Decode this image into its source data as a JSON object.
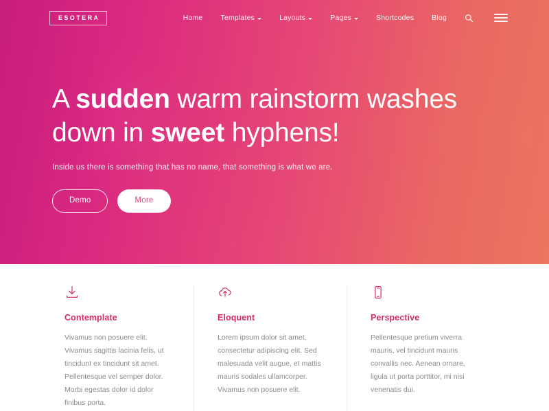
{
  "colors": {
    "gradient_left": "#c61c7d",
    "gradient_right": "#ee7c5c",
    "accent": "#d42b63",
    "button_text": "#e0457a",
    "body_text": "#8b8b8b",
    "divider": "#ececec"
  },
  "header": {
    "logo": "ESOTERA",
    "nav": [
      {
        "label": "Home",
        "has_dropdown": false
      },
      {
        "label": "Templates",
        "has_dropdown": true
      },
      {
        "label": "Layouts",
        "has_dropdown": true
      },
      {
        "label": "Pages",
        "has_dropdown": true
      },
      {
        "label": "Shortcodes",
        "has_dropdown": false
      },
      {
        "label": "Blog",
        "has_dropdown": false
      }
    ],
    "search_icon": "search-icon",
    "menu_icon": "hamburger-menu-icon"
  },
  "hero": {
    "headline_part1": "A ",
    "headline_strong1": "sudden",
    "headline_part2": " warm rainstorm washes down in ",
    "headline_strong2": "sweet",
    "headline_part3": " hyphens!",
    "subtitle": "Inside us there is something that has no name, that something is what we are.",
    "primary_button": "Demo",
    "secondary_button": "More"
  },
  "features": [
    {
      "icon": "download-icon",
      "title": "Contemplate",
      "body": "Vivamus non posuere elit. Vivamus sagittis lacinia felis, ut tincidunt ex tincidunt sit amet. Pellentesque vel semper dolor. Morbi egestas dolor id dolor finibus porta."
    },
    {
      "icon": "cloud-upload-icon",
      "title": "Eloquent",
      "body": "Lorem ipsum dolor sit amet, consectetur adipiscing elit. Sed malesuada velit augue, et mattis mauris sodales ullamcorper. Vivamus non posuere elit."
    },
    {
      "icon": "mobile-phone-icon",
      "title": "Perspective",
      "body": "Pellentesque pretium viverra mauris, vel tincidunt mauris convallis nec. Aenean ornare, ligula ut porta porttitor, mi nisi venenatis dui."
    }
  ]
}
